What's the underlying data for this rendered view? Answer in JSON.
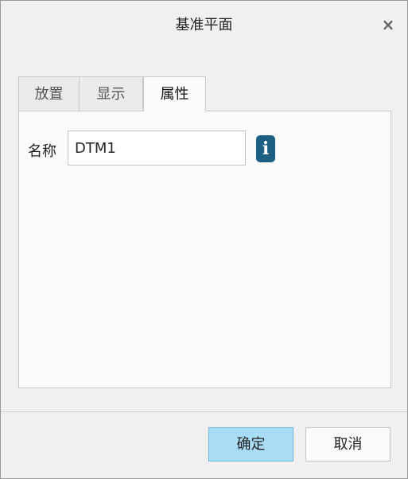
{
  "dialog": {
    "title": "基准平面",
    "close_glyph": "×"
  },
  "tabs": [
    {
      "label": "放置",
      "active": false
    },
    {
      "label": "显示",
      "active": false
    },
    {
      "label": "属性",
      "active": true
    }
  ],
  "properties": {
    "name_label": "名称",
    "name_value": "DTM1",
    "info_icon": "info-icon",
    "info_glyph": "i"
  },
  "buttons": {
    "ok_label": "确定",
    "cancel_label": "取消"
  },
  "colors": {
    "ok_button": "#a9dcf5",
    "info_icon": "#1d5f83"
  }
}
